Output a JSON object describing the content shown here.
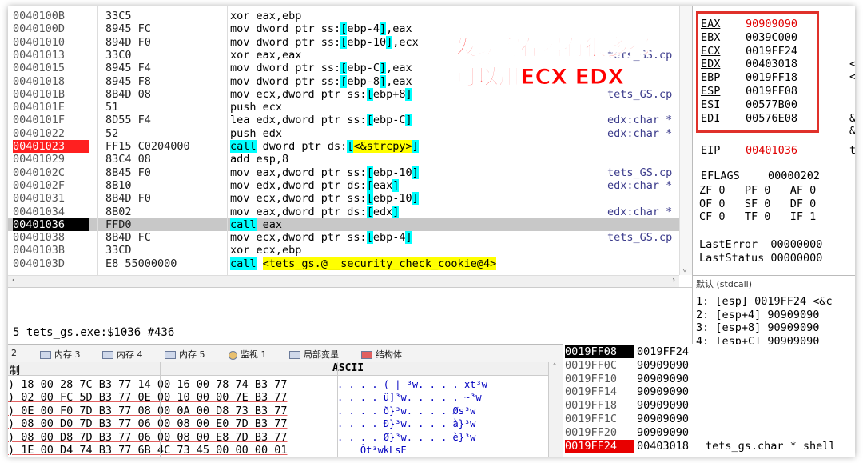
{
  "disasm": {
    "rows": [
      {
        "addr": "0040100B",
        "bytes": "33C5",
        "ins": "xor eax,ebp",
        "cmt": ""
      },
      {
        "addr": "0040100D",
        "bytes": "8945 FC",
        "ins": "mov dword ptr ss:[ebp-4],eax",
        "cmt": ""
      },
      {
        "addr": "00401010",
        "bytes": "894D F0",
        "ins": "mov dword ptr ss:[ebp-10],ecx",
        "cmt": ""
      },
      {
        "addr": "00401013",
        "bytes": "33C0",
        "ins": "xor eax,eax",
        "cmt": "tets_GS.cp"
      },
      {
        "addr": "00401015",
        "bytes": "8945 F4",
        "ins": "mov dword ptr ss:[ebp-C],eax",
        "cmt": ""
      },
      {
        "addr": "00401018",
        "bytes": "8945 F8",
        "ins": "mov dword ptr ss:[ebp-8],eax",
        "cmt": ""
      },
      {
        "addr": "0040101B",
        "bytes": "8B4D 08",
        "ins": "mov ecx,dword ptr ss:[ebp+8]",
        "cmt": "tets_GS.cp"
      },
      {
        "addr": "0040101E",
        "bytes": "51",
        "ins": "push ecx",
        "cmt": ""
      },
      {
        "addr": "0040101F",
        "bytes": "8D55 F4",
        "ins": "lea edx,dword ptr ss:[ebp-C]",
        "cmt": "edx:char *"
      },
      {
        "addr": "00401022",
        "bytes": "52",
        "ins": "push edx",
        "cmt": "edx:char *"
      },
      {
        "addr": "00401023",
        "bytes": "FF15 C0204000",
        "ins": "call dword ptr ds:[<&strcpy>]",
        "cmt": ""
      },
      {
        "addr": "00401029",
        "bytes": "83C4 08",
        "ins": "add esp,8",
        "cmt": ""
      },
      {
        "addr": "0040102C",
        "bytes": "8B45 F0",
        "ins": "mov eax,dword ptr ss:[ebp-10]",
        "cmt": "tets_GS.cp"
      },
      {
        "addr": "0040102F",
        "bytes": "8B10",
        "ins": "mov edx,dword ptr ds:[eax]",
        "cmt": "edx:char *"
      },
      {
        "addr": "00401031",
        "bytes": "8B4D F0",
        "ins": "mov ecx,dword ptr ss:[ebp-10]",
        "cmt": ""
      },
      {
        "addr": "00401034",
        "bytes": "8B02",
        "ins": "mov eax,dword ptr ds:[edx]",
        "cmt": "edx:char *"
      },
      {
        "addr": "00401036",
        "bytes": "FFD0",
        "ins": "call eax",
        "cmt": ""
      },
      {
        "addr": "00401038",
        "bytes": "8B4D FC",
        "ins": "mov ecx,dword ptr ss:[ebp-4]",
        "cmt": "tets_GS.cp"
      },
      {
        "addr": "0040103B",
        "bytes": "33CD",
        "ins": "xor ecx,ebp",
        "cmt": ""
      },
      {
        "addr": "0040103D",
        "bytes": "E8 55000000",
        "ins": "call <tets_gs.@__security_check_cookie@4>",
        "cmt": ""
      }
    ],
    "overlay_line1": "发现寄存器有很多都",
    "overlay_line2": "可以用ECX EDX"
  },
  "info_line": "5 tets_gs.exe:$1036 #436",
  "registers": {
    "list": [
      {
        "name": "EAX",
        "value": "90909090",
        "red": true
      },
      {
        "name": "EBX",
        "value": "0039C000",
        "red": false
      },
      {
        "name": "ECX",
        "value": "0019FF24",
        "red": false
      },
      {
        "name": "EDX",
        "value": "00403018",
        "red": false
      },
      {
        "name": "EBP",
        "value": "0019FF18",
        "red": false
      },
      {
        "name": "ESP",
        "value": "0019FF08",
        "red": false
      },
      {
        "name": "ESI",
        "value": "00577B00",
        "red": false
      },
      {
        "name": "EDI",
        "value": "00576E08",
        "red": false
      }
    ],
    "side_marks": [
      "<",
      "<",
      "&",
      "&"
    ],
    "eip": {
      "name": "EIP",
      "value": "00401036",
      "tail": "t"
    },
    "eflags": {
      "name": "EFLAGS",
      "value": "00000202"
    },
    "flags": [
      "ZF 0   PF 0   AF 0",
      "OF 0   SF 0   DF 0",
      "CF 0   TF 0   IF 1"
    ],
    "lasterror": "LastError  00000000",
    "laststatus": "LastStatus 00000000"
  },
  "callstack": {
    "header": "默认 (stdcall)",
    "lines": [
      "1: [esp] 0019FF24 <&c",
      "2: [esp+4] 90909090",
      "3: [esp+8] 90909090",
      "4: [esp+C] 90909090"
    ]
  },
  "tabs": [
    "2",
    "内存 3",
    "内存 4",
    "内存 5",
    "监视 1",
    "局部变量",
    "结构体"
  ],
  "dump": {
    "hdr_left": "制",
    "hdr_ascii": "ASCII",
    "rows": [
      {
        "hex": ") 18 00 28 7C B3 77 14 00 16 00 78 74 B3 77",
        "ascii": ". . . . ( | ³w. . . . xt³w"
      },
      {
        "hex": ") 02 00 FC 5D B3 77 0E 00 10 00 00 7E B3 77",
        "ascii": ". . . . ü]³w. . . . . ~³w"
      },
      {
        "hex": ") 0E 00 F0 7D B3 77 08 00 0A 00 D8 73 B3 77",
        "ascii": ". . . . ð}³w. . . . Øs³w"
      },
      {
        "hex": ") 08 00 D0 7D B3 77 06 00 08 00 E0 7D B3 77",
        "ascii": ". . . . Ð}³w. . . . à}³w"
      },
      {
        "hex": ") 08 00 D8 7D B3 77 06 00 08 00 E8 7D B3 77",
        "ascii": ". . . . Ø}³w. . . . è}³w"
      },
      {
        "hex": ") 1E 00 D4 74 B3 77 6B 4C 73 45 00 00 00 01",
        "ascii": "    Ôt³wkLsE"
      }
    ]
  },
  "stackview": {
    "rows": [
      {
        "addr": "0019FF08",
        "val": "0019FF24",
        "cmt": "",
        "style": "top"
      },
      {
        "addr": "0019FF0C",
        "val": "90909090",
        "cmt": "",
        "style": ""
      },
      {
        "addr": "0019FF10",
        "val": "90909090",
        "cmt": "",
        "style": ""
      },
      {
        "addr": "0019FF14",
        "val": "90909090",
        "cmt": "",
        "style": ""
      },
      {
        "addr": "0019FF18",
        "val": "90909090",
        "cmt": "",
        "style": ""
      },
      {
        "addr": "0019FF1C",
        "val": "90909090",
        "cmt": "",
        "style": ""
      },
      {
        "addr": "0019FF20",
        "val": "90909090",
        "cmt": "",
        "style": ""
      },
      {
        "addr": "0019FF24",
        "val": "00403018",
        "cmt": "tets_gs.char * shell",
        "style": "red"
      }
    ]
  },
  "colors": {
    "breakpoint": "#ff2020",
    "register_box": "#e0312a",
    "overlay": "#ff0000",
    "highlight_cyan": "#00ffff",
    "highlight_yellow": "#ffff00"
  }
}
